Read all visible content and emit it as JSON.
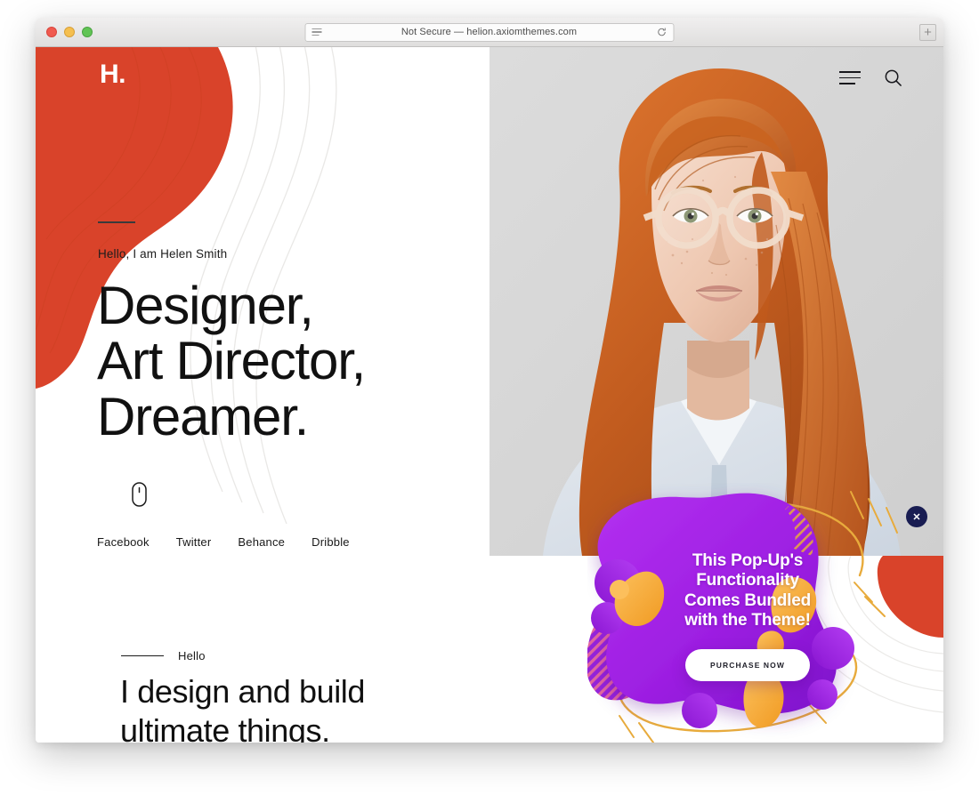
{
  "browser": {
    "url_text": "Not Secure — helion.axiomthemes.com",
    "reload_label": "⟳",
    "newtab_label": "+",
    "traffic_lights": [
      "close",
      "minimize",
      "maximize"
    ]
  },
  "site": {
    "logo": "H.",
    "nav": {
      "menu_icon": "hamburger-menu-icon",
      "search_icon": "search-icon"
    },
    "hero": {
      "intro": "Hello, I am Helen Smith",
      "headline": "Designer,\nArt Director,\nDreamer.",
      "scroll_icon": "mouse-scroll-icon",
      "social": [
        {
          "label": "Facebook"
        },
        {
          "label": "Twitter"
        },
        {
          "label": "Behance"
        },
        {
          "label": "Dribble"
        }
      ],
      "portrait_alt": "portrait-of-red-haired-woman-with-glasses"
    },
    "about": {
      "label": "Hello",
      "heading": "I design and build\nultimate things."
    }
  },
  "popup": {
    "title": "This Pop-Up's\nFunctionality\nComes Bundled\nwith the Theme!",
    "cta_label": "PURCHASE NOW",
    "close_label": "✕"
  },
  "colors": {
    "brand_orange": "#d9432a",
    "popup_purple": "#a020e8",
    "popup_purple_dark": "#8113d6",
    "popup_orange": "#f5a93c",
    "popup_gold": "#e8ab3c",
    "close_navy": "#191d52",
    "text_dark": "#111111"
  }
}
